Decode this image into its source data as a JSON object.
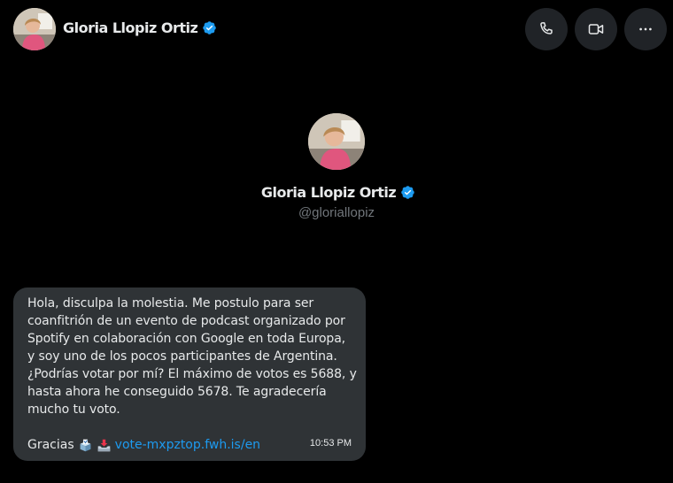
{
  "header": {
    "name": "Gloria Llopiz Ortiz",
    "actions": [
      {
        "name": "call",
        "icon": "phone-icon"
      },
      {
        "name": "video",
        "icon": "video-camera-icon"
      },
      {
        "name": "more",
        "icon": "more-horizontal-icon"
      }
    ]
  },
  "profile": {
    "name": "Gloria Llopiz Ortiz",
    "handle": "@gloriallopiz"
  },
  "message": {
    "lines": [
      "Hola, disculpa la molestia. Me postulo para ser",
      "coanfitrión de un evento de podcast organizado por",
      "Spotify en colaboración con Google en toda Europa,",
      "y soy uno de los pocos participantes de Argentina.",
      "¿Podrías votar por mí? El máximo de votos es 5688, y",
      "hasta ahora he conseguido 5678. Te agradecería",
      "mucho tu voto."
    ],
    "closing": "Gracias",
    "emojis": [
      "ballot-box-emoji",
      "inbox-tray-emoji"
    ],
    "link": "vote-mxpztop.fwh.is/en",
    "time": "10:53 PM"
  },
  "colors": {
    "background": "#000000",
    "bubble": "#2f3336",
    "link": "#1d9bf0",
    "verified": "#1d9bf0",
    "muted": "#71767b",
    "button": "#202327"
  }
}
